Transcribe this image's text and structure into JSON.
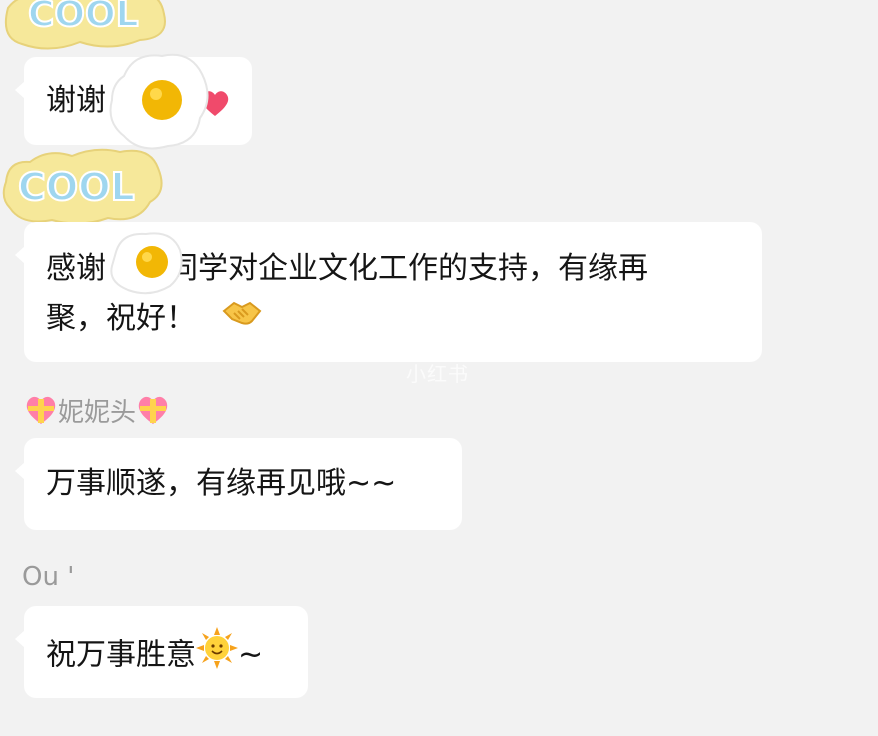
{
  "stickers": {
    "cool_text": "COOL"
  },
  "messages": [
    {
      "text": "谢谢"
    },
    {
      "line1": "感谢",
      "line1b": "同学对企业文化工作的支持，有缘再",
      "line2": "聚，祝好！"
    },
    {
      "sender": "妮妮头",
      "text": "万事顺遂，有缘再见哦~~"
    },
    {
      "sender": "Ou '",
      "text": "祝万事胜意",
      "suffix": "~"
    }
  ],
  "watermark": "小红书",
  "colors": {
    "background": "#f2f2f2",
    "bubble": "#ffffff",
    "sender": "#9a9a9a",
    "text": "#151515"
  }
}
